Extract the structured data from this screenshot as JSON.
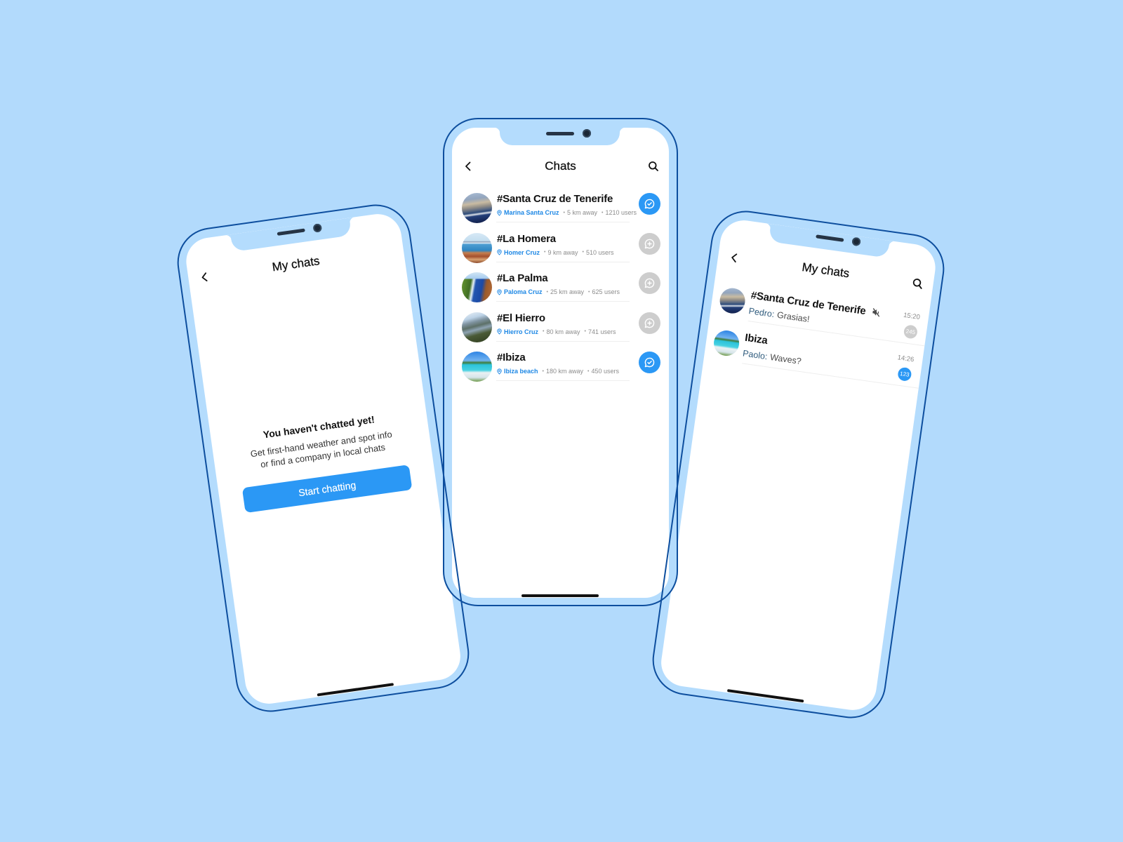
{
  "theme": {
    "background": "#b2dafc",
    "bezel": "#b4dcfd",
    "outline": "#0d4e9e",
    "accent": "#2b98f5",
    "link": "#1e88e5",
    "inactive": "#cdcdcd"
  },
  "icons": {
    "back": "chevron-left-icon",
    "search": "search-icon",
    "location": "map-pin-icon",
    "join": "chat-plus-icon",
    "joined": "chat-check-icon",
    "muted": "mute-icon"
  },
  "phones": {
    "left": {
      "header": {
        "title": "My chats"
      },
      "empty_state": {
        "heading": "You haven't chatted yet!",
        "line1": "Get first-hand weather and spot info",
        "line2": "or find a company in local chats",
        "button_label": "Start chatting"
      }
    },
    "center": {
      "header": {
        "title": "Chats"
      },
      "separator": "•",
      "chats": [
        {
          "name": "#Santa Cruz de Tenerife",
          "location": "Marina Santa Cruz",
          "distance": "5 km away",
          "users": "1210 users",
          "status": "joined",
          "avatar": "harbor-photo"
        },
        {
          "name": "#La Homera",
          "location": "Homer Cruz",
          "distance": "9 km away",
          "users": "510 users",
          "status": "not-joined",
          "avatar": "coast-town-photo"
        },
        {
          "name": "#La Palma",
          "location": "Paloma Cruz",
          "distance": "25 km away",
          "users": "625 users",
          "status": "not-joined",
          "avatar": "green-cliffs-photo"
        },
        {
          "name": "#El Hierro",
          "location": "Hierro Cruz",
          "distance": "80 km away",
          "users": "741 users",
          "status": "not-joined",
          "avatar": "hills-coast-photo"
        },
        {
          "name": "#Ibiza",
          "location": "Ibiza beach",
          "distance": "180 km away",
          "users": "450 users",
          "status": "joined",
          "avatar": "beach-photo"
        }
      ]
    },
    "right": {
      "header": {
        "title": "My chats"
      },
      "chats": [
        {
          "name": "#Santa Cruz de Tenerife",
          "sender": "Pedro:",
          "message": "Grasias!",
          "time": "15:20",
          "unread": "245",
          "muted": true,
          "avatar": "harbor-photo"
        },
        {
          "name": "Ibiza",
          "sender": "Paolo:",
          "message": "Waves?",
          "time": "14:26",
          "unread": "123",
          "muted": false,
          "avatar": "beach-photo"
        }
      ]
    }
  }
}
